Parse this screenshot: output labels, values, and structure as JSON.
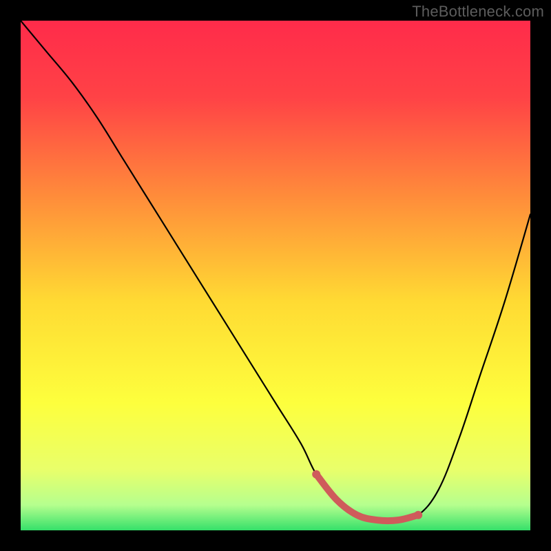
{
  "watermark": "TheBottleneck.com",
  "chart_data": {
    "type": "line",
    "title": "",
    "xlabel": "",
    "ylabel": "",
    "xlim": [
      0,
      100
    ],
    "ylim": [
      0,
      100
    ],
    "grid": false,
    "legend": false,
    "background_gradient": {
      "stops": [
        {
          "offset": 0.0,
          "color": "#ff2b4a"
        },
        {
          "offset": 0.15,
          "color": "#ff4246"
        },
        {
          "offset": 0.35,
          "color": "#ff8e3a"
        },
        {
          "offset": 0.55,
          "color": "#ffda33"
        },
        {
          "offset": 0.75,
          "color": "#fdff3d"
        },
        {
          "offset": 0.88,
          "color": "#e9ff6a"
        },
        {
          "offset": 0.95,
          "color": "#b6ff8e"
        },
        {
          "offset": 1.0,
          "color": "#35e06a"
        }
      ]
    },
    "series": [
      {
        "name": "bottleneck-curve",
        "color": "#000000",
        "x": [
          0,
          5,
          10,
          15,
          20,
          25,
          30,
          35,
          40,
          45,
          50,
          55,
          58,
          62,
          66,
          70,
          74,
          78,
          82,
          86,
          90,
          95,
          100
        ],
        "y": [
          100,
          94,
          88,
          81,
          73,
          65,
          57,
          49,
          41,
          33,
          25,
          17,
          11,
          6,
          3,
          2,
          2,
          3,
          8,
          18,
          30,
          45,
          62
        ]
      }
    ],
    "highlight": {
      "name": "optimal-range",
      "color": "#cf5b5b",
      "x": [
        58,
        62,
        66,
        70,
        74,
        78
      ],
      "y": [
        11,
        6,
        3,
        2,
        2,
        3
      ]
    }
  }
}
